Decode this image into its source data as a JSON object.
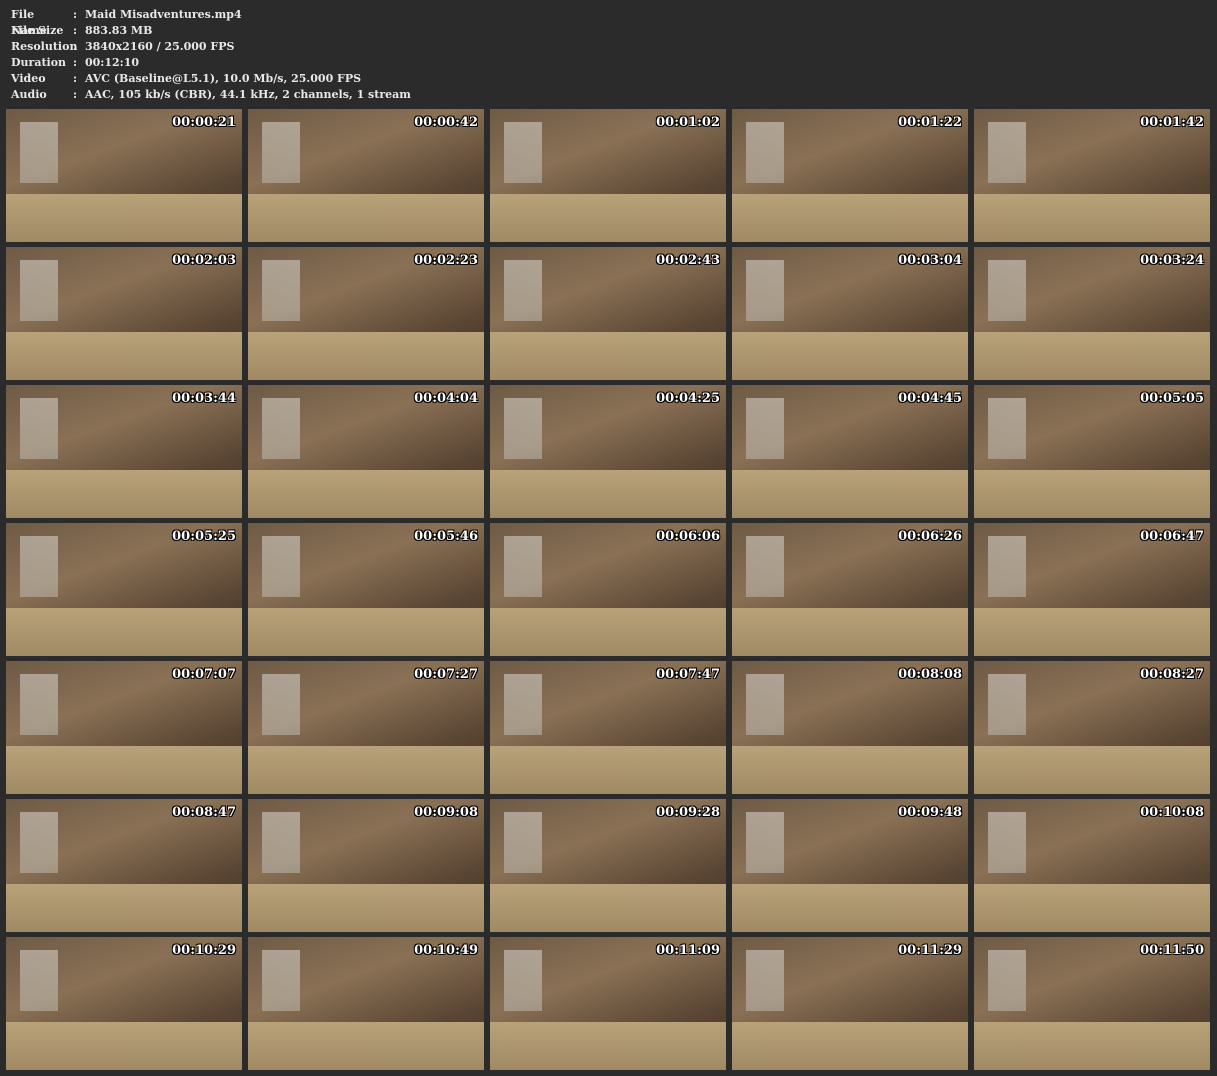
{
  "info": [
    {
      "label": "File Name",
      "value": "Maid Misadventures.mp4"
    },
    {
      "label": "File Size",
      "value": "883.83 MB"
    },
    {
      "label": "Resolution",
      "value": "3840x2160 / 25.000 FPS"
    },
    {
      "label": "Duration",
      "value": "00:12:10"
    },
    {
      "label": "Video",
      "value": "AVC (Baseline@L5.1), 10.0 Mb/s, 25.000 FPS"
    },
    {
      "label": "Audio",
      "value": "AAC, 105 kb/s (CBR), 44.1 kHz, 2 channels, 1 stream"
    }
  ],
  "separator": ":",
  "thumbnails": [
    "00:00:21",
    "00:00:42",
    "00:01:02",
    "00:01:22",
    "00:01:42",
    "00:02:03",
    "00:02:23",
    "00:02:43",
    "00:03:04",
    "00:03:24",
    "00:03:44",
    "00:04:04",
    "00:04:25",
    "00:04:45",
    "00:05:05",
    "00:05:25",
    "00:05:46",
    "00:06:06",
    "00:06:26",
    "00:06:47",
    "00:07:07",
    "00:07:27",
    "00:07:47",
    "00:08:08",
    "00:08:27",
    "00:08:47",
    "00:09:08",
    "00:09:28",
    "00:09:48",
    "00:10:08",
    "00:10:29",
    "00:10:49",
    "00:11:09",
    "00:11:29",
    "00:11:50"
  ]
}
